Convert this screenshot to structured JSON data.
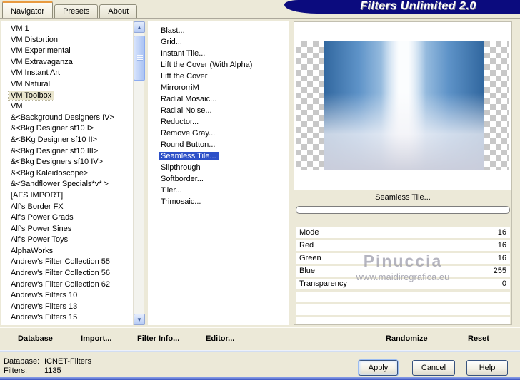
{
  "app": {
    "title": "Filters Unlimited 2.0"
  },
  "tabs": [
    {
      "label": "Navigator",
      "active": true
    },
    {
      "label": "Presets",
      "active": false
    },
    {
      "label": "About",
      "active": false
    }
  ],
  "category_list": {
    "selected_index": 6,
    "items": [
      "VM 1",
      "VM Distortion",
      "VM Experimental",
      "VM Extravaganza",
      "VM Instant Art",
      "VM Natural",
      "VM Toolbox",
      "VM",
      "&<Background Designers IV>",
      "&<Bkg Designer sf10 I>",
      "&<BKg Designer sf10 II>",
      "&<Bkg Designer sf10 III>",
      "&<Bkg Designers sf10 IV>",
      "&<Bkg Kaleidoscope>",
      "&<Sandflower Specials*v* >",
      "[AFS IMPORT]",
      "Alf's Border FX",
      "Alf's Power Grads",
      "Alf's Power Sines",
      "Alf's Power Toys",
      "AlphaWorks",
      "Andrew's Filter Collection 55",
      "Andrew's Filter Collection 56",
      "Andrew's Filter Collection 62",
      "Andrew's Filters 10",
      "Andrew's Filters 13",
      "Andrew's Filters 15"
    ]
  },
  "filter_list": {
    "selected_index": 11,
    "items": [
      "Blast...",
      "Grid...",
      "Instant Tile...",
      "Lift the Cover (With Alpha)",
      "Lift the Cover",
      "MirrororriM",
      "Radial Mosaic...",
      "Radial Noise...",
      "Reductor...",
      "Remove Gray...",
      "Round Button...",
      "Seamless Tile...",
      "Slipthrough",
      "Softborder...",
      "Tiler...",
      "Trimosaic..."
    ]
  },
  "preview": {
    "selected_filter_label": "Seamless Tile...",
    "progress_percent": 0
  },
  "parameters": [
    {
      "name": "Mode",
      "value": "16"
    },
    {
      "name": "Red",
      "value": "16"
    },
    {
      "name": "Green",
      "value": "16"
    },
    {
      "name": "Blue",
      "value": "255"
    },
    {
      "name": "Transparency",
      "value": "0"
    }
  ],
  "watermark": {
    "name": "Pinuccia",
    "site": "www.maidiregrafica.eu"
  },
  "toolbar": [
    {
      "label": "Database",
      "underline_index": 0
    },
    {
      "label": "Import...",
      "underline_index": 0
    },
    {
      "label": "Filter Info...",
      "underline_index": 7
    },
    {
      "label": "Editor...",
      "underline_index": 0
    },
    {
      "label": "Randomize",
      "underline_index": -1
    },
    {
      "label": "Reset",
      "underline_index": -1
    }
  ],
  "status": {
    "database_label": "Database:",
    "database_value": "ICNET-Filters",
    "filters_label": "Filters:",
    "filters_value": "1135"
  },
  "action_buttons": [
    {
      "label": "Apply",
      "focused": true
    },
    {
      "label": "Cancel",
      "focused": false
    },
    {
      "label": "Help",
      "focused": false
    }
  ],
  "colors": {
    "dialog_beige": "#ece9d8",
    "banner_navy": "#0b0b7e",
    "selection_blue": "#2d50c8",
    "tab_accent_orange": "#e89a40",
    "category_selection_beige": "#e9e5cd"
  }
}
